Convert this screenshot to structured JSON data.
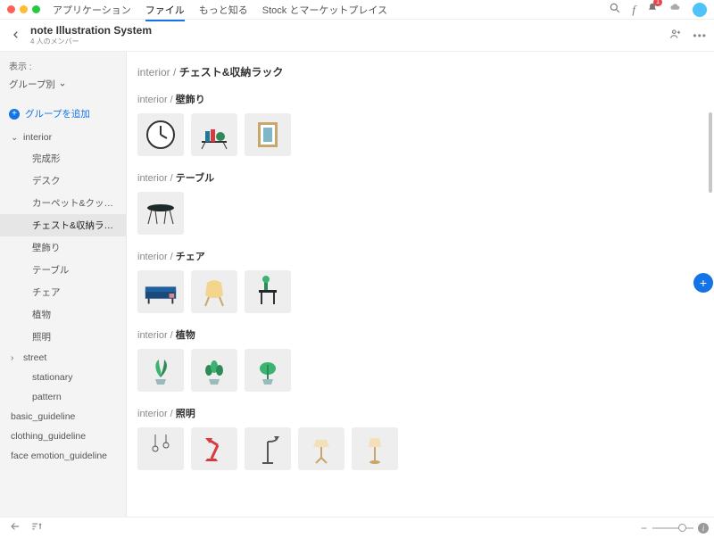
{
  "traffic": [
    "#ff5f57",
    "#febc2e",
    "#28c840"
  ],
  "menu": {
    "items": [
      "アプリケーション",
      "ファイル",
      "もっと知る",
      "Stock とマーケットプレイス"
    ],
    "active": 1
  },
  "notif_count": "1",
  "avatar_color": "#4fc3f7",
  "project": {
    "title": "note Illustration System",
    "members": "4 人のメンバー"
  },
  "sidebar": {
    "show_label": "表示 :",
    "view_mode": "グループ別",
    "add_group": "グループを追加",
    "root": "interior",
    "children": [
      "完成形",
      "デスク",
      "カーペット&クッシ...",
      "チェスト&収納ラック",
      "壁飾り",
      "テーブル",
      "チェア",
      "植物",
      "照明"
    ],
    "selected": "チェスト&収納ラック",
    "root2": "street",
    "loose": [
      "stationary",
      "pattern"
    ],
    "bottoms": [
      "basic_guideline",
      "clothing_guideline",
      "face emotion_guideline"
    ]
  },
  "sections": [
    {
      "crumb_cat": "interior",
      "crumb_name": "チェスト&収納ラック",
      "big": true,
      "tiles": []
    },
    {
      "crumb_cat": "interior",
      "crumb_name": "壁飾り",
      "tiles": [
        "clock",
        "shelf",
        "frame"
      ]
    },
    {
      "crumb_cat": "interior",
      "crumb_name": "テーブル",
      "tiles": [
        "table"
      ]
    },
    {
      "crumb_cat": "interior",
      "crumb_name": "チェア",
      "tiles": [
        "sofa",
        "chair-yellow",
        "side-table"
      ]
    },
    {
      "crumb_cat": "interior",
      "crumb_name": "植物",
      "tiles": [
        "plant-a",
        "plant-b",
        "plant-c"
      ]
    },
    {
      "crumb_cat": "interior",
      "crumb_name": "照明",
      "tiles": [
        "lamp-hang",
        "lamp-red",
        "lamp-floor",
        "lamp-shade1",
        "lamp-shade2"
      ]
    }
  ]
}
